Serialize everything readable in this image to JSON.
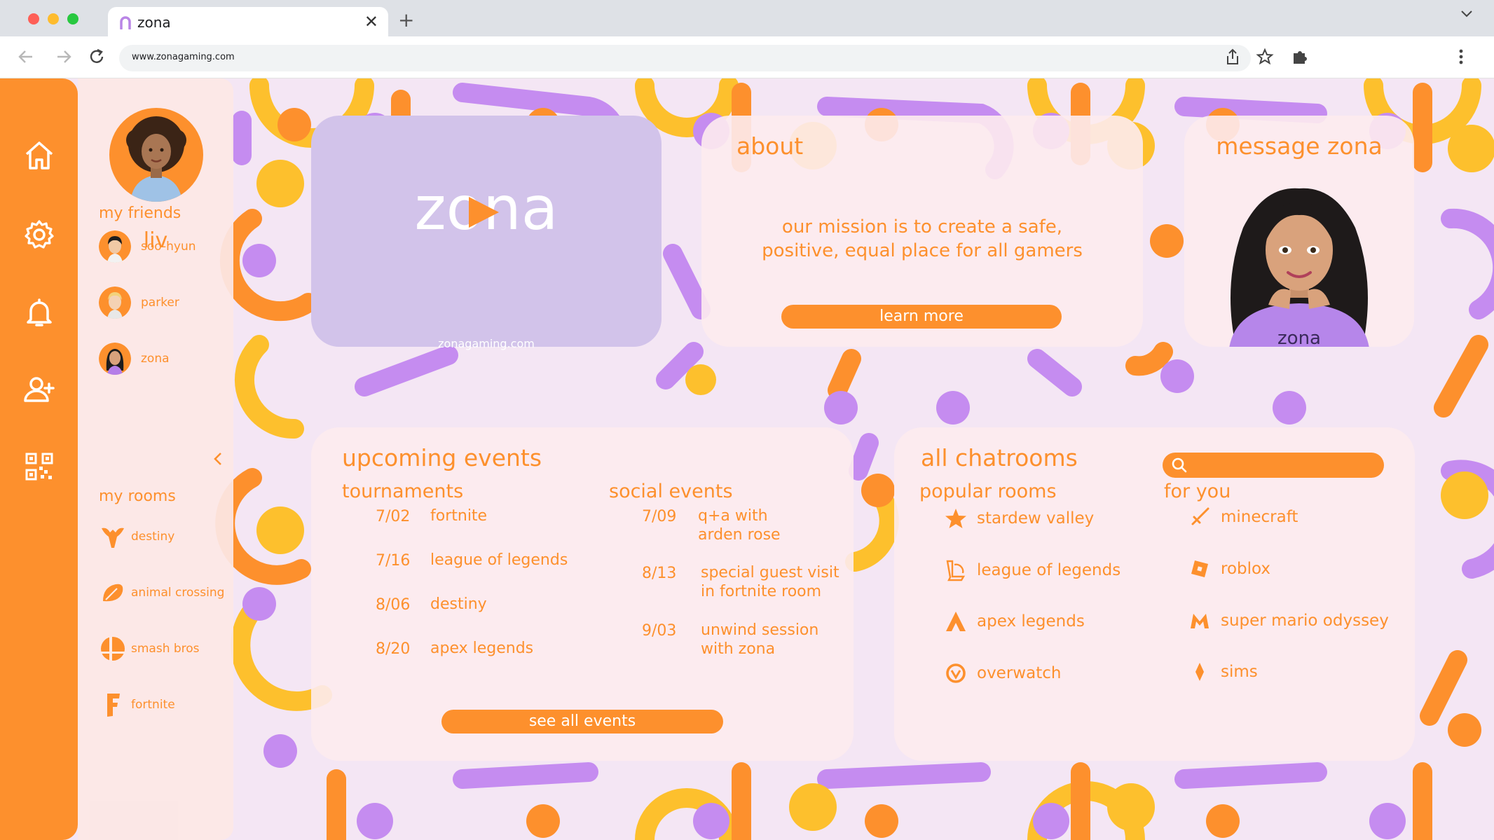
{
  "browser": {
    "tab_title": "zona",
    "url": "www.zonagaming.com"
  },
  "rail": {
    "icons": [
      "home-icon",
      "gear-icon",
      "bell-icon",
      "add-user-icon",
      "qr-code-icon"
    ]
  },
  "sidebar": {
    "user_name": "liv",
    "friends_heading": "my friends",
    "friends": [
      {
        "name": "soo-hyun"
      },
      {
        "name": "parker"
      },
      {
        "name": "zona"
      }
    ],
    "rooms_heading": "my rooms",
    "rooms": [
      {
        "name": "destiny",
        "icon": "destiny-icon"
      },
      {
        "name": "animal crossing",
        "icon": "leaf-icon"
      },
      {
        "name": "smash bros",
        "icon": "smash-icon"
      },
      {
        "name": "fortnite",
        "icon": "fortnite-icon"
      }
    ]
  },
  "logo_card": {
    "wordmark": "zona",
    "site": "zonagaming.com"
  },
  "about": {
    "title": "about",
    "text_line1": "our mission is to create a safe,",
    "text_line2": "positive, equal place for all gamers",
    "button": "learn more"
  },
  "message": {
    "title": "message zona",
    "shirt_text": "zona"
  },
  "events": {
    "title": "upcoming events",
    "tournaments_heading": "tournaments",
    "tournaments": [
      {
        "date": "7/02",
        "name": "fortnite"
      },
      {
        "date": "7/16",
        "name": "league of legends"
      },
      {
        "date": "8/06",
        "name": "destiny"
      },
      {
        "date": "8/20",
        "name": "apex legends"
      }
    ],
    "social_heading": "social events",
    "social": [
      {
        "date": "7/09",
        "line1": "q+a with",
        "line2": "arden rose"
      },
      {
        "date": "8/13",
        "line1": "special guest visit",
        "line2": "in fortnite room"
      },
      {
        "date": "9/03",
        "line1": "unwind session",
        "line2": "with zona"
      }
    ],
    "button": "see all events"
  },
  "chatrooms": {
    "title": "all chatrooms",
    "search_placeholder": "",
    "popular_heading": "popular rooms",
    "popular": [
      {
        "name": "stardew valley",
        "icon": "star-icon"
      },
      {
        "name": "league of legends",
        "icon": "league-icon"
      },
      {
        "name": "apex legends",
        "icon": "apex-icon"
      },
      {
        "name": "overwatch",
        "icon": "overwatch-icon"
      }
    ],
    "for_you_heading": "for you",
    "for_you": [
      {
        "name": "minecraft",
        "icon": "sword-icon"
      },
      {
        "name": "roblox",
        "icon": "roblox-icon"
      },
      {
        "name": "super mario odyssey",
        "icon": "mario-icon"
      },
      {
        "name": "sims",
        "icon": "plumbob-icon"
      }
    ]
  },
  "colors": {
    "orange": "#fd902d",
    "purple": "#c58cf0",
    "yellow": "#fdc02d",
    "lavender": "#d2c3ea",
    "background": "#f4e6f4"
  }
}
